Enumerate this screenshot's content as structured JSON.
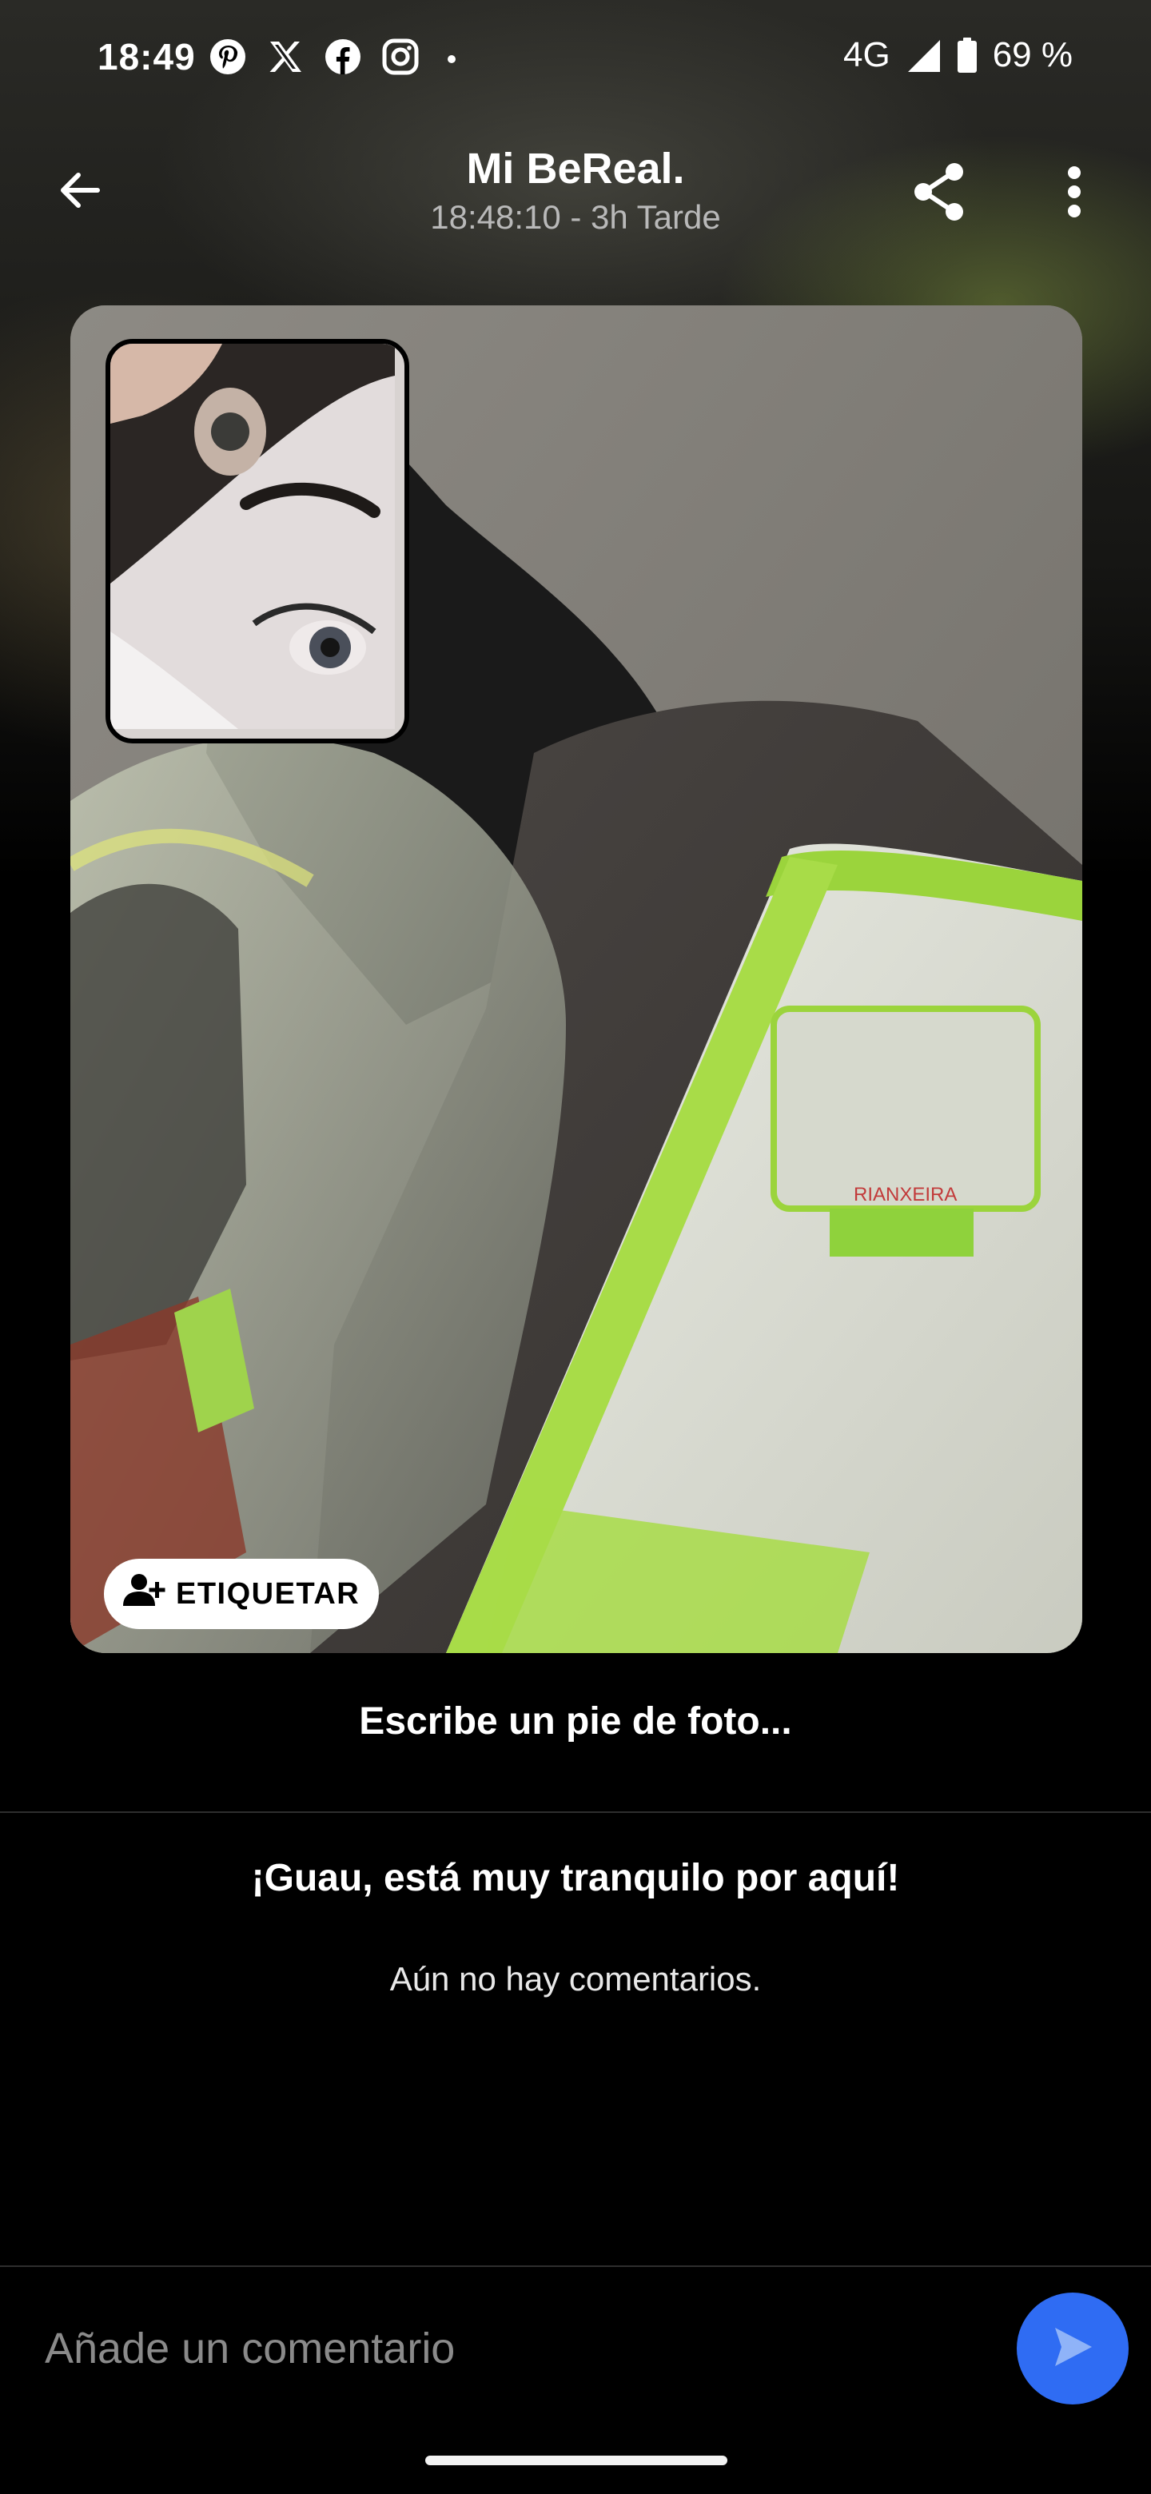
{
  "status_bar": {
    "time": "18:49",
    "notification_icons": [
      "pinterest-icon",
      "x-icon",
      "facebook-icon",
      "instagram-icon",
      "dot-icon"
    ],
    "network": "4G",
    "battery": "69 %"
  },
  "header": {
    "title": "Mi BeReal.",
    "subtitle": "18:48:10 - 3h Tarde"
  },
  "photo": {
    "tag_label": "ETIQUETAR"
  },
  "caption": {
    "placeholder": "Escribe un pie de foto..."
  },
  "comments": {
    "empty_title": "¡Guau, está muy tranquilo por aquí!",
    "empty_subtitle": "Aún no hay comentarios."
  },
  "comment_bar": {
    "placeholder": "Añade un comentario"
  },
  "colors": {
    "send_button": "#2f6cf3",
    "background": "#000000"
  }
}
